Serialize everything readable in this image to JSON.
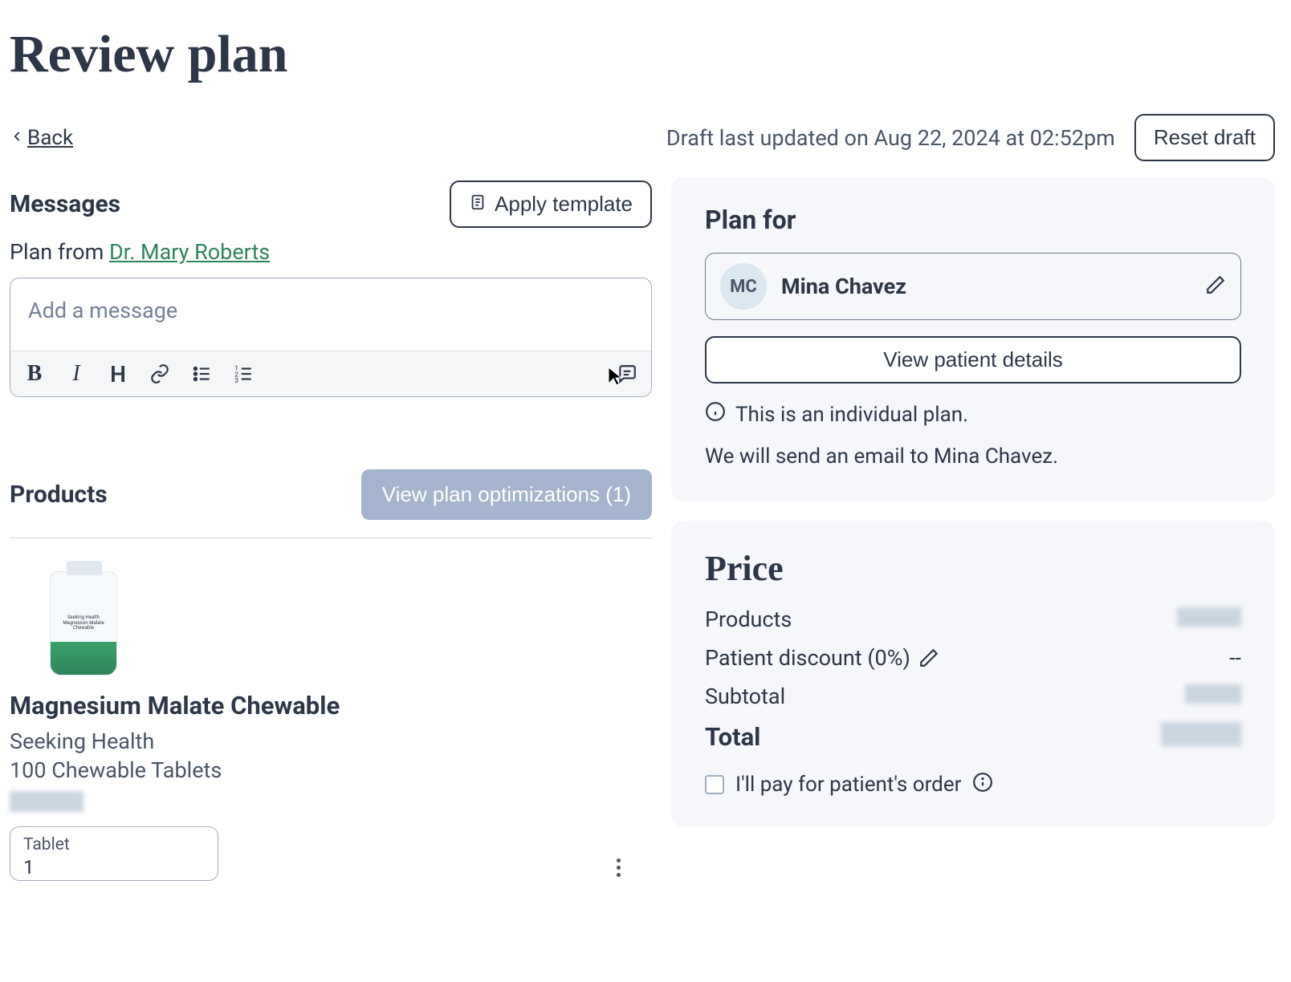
{
  "page_title": "Review plan",
  "topbar": {
    "back_label": "Back",
    "draft_status": "Draft last updated on Aug 22, 2024 at 02:52pm",
    "reset_label": "Reset draft"
  },
  "messages": {
    "heading": "Messages",
    "apply_template_label": "Apply template",
    "plan_from_text": "Plan from ",
    "plan_from_name": "Dr. Mary Roberts",
    "placeholder": "Add a message"
  },
  "products": {
    "heading": "Products",
    "optimizations_label": "View plan optimizations (1)",
    "items": [
      {
        "name": "Magnesium Malate Chewable",
        "brand": "Seeking Health",
        "size": "100 Chewable Tablets",
        "form_label": "Tablet",
        "form_value": "1"
      }
    ]
  },
  "plan_for": {
    "heading": "Plan for",
    "initials": "MC",
    "patient_name": "Mina Chavez",
    "view_details_label": "View patient details",
    "info_text": "This is an individual plan.",
    "email_note": "We will send an email to Mina Chavez."
  },
  "price": {
    "heading": "Price",
    "products_label": "Products",
    "discount_label": "Patient discount (0%)",
    "discount_value": "--",
    "subtotal_label": "Subtotal",
    "total_label": "Total",
    "pay_for_label": "I'll pay for patient's order"
  }
}
